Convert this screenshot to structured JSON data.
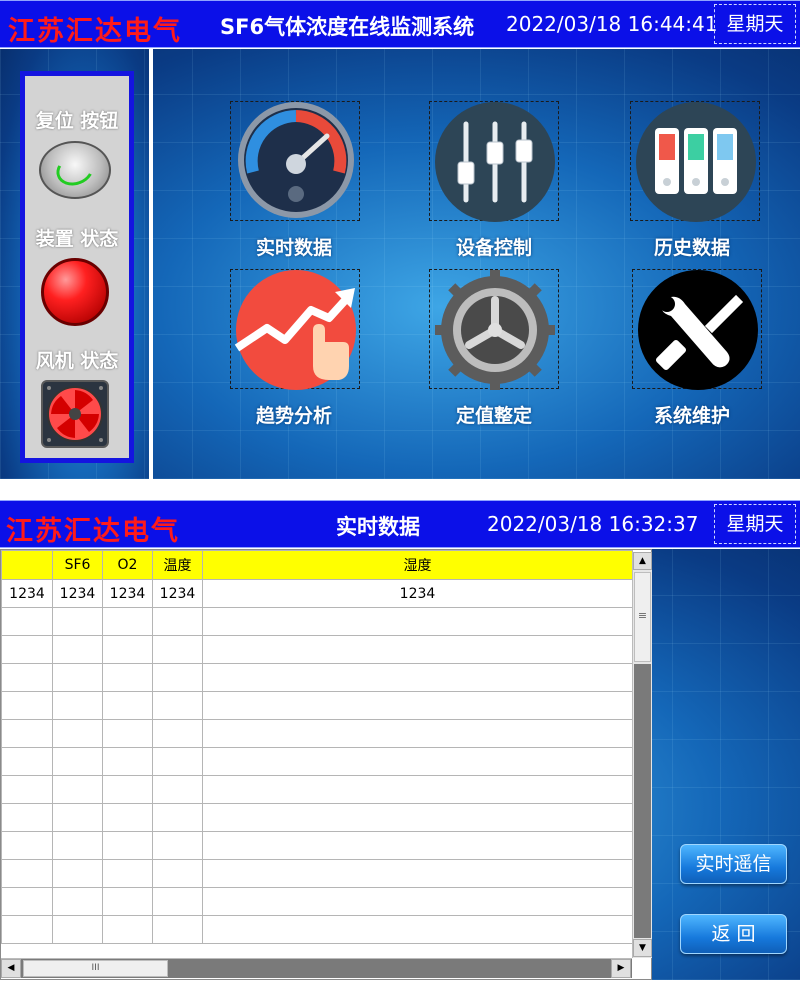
{
  "screen1": {
    "header": {
      "brand": "江苏汇达电气",
      "title": "SF6气体浓度在线监测系统",
      "datetime": "2022/03/18 16:44:41",
      "weekday": "星期天"
    },
    "left_panel": {
      "reset_label": "复位 按钮",
      "device_status_label": "装置 状态",
      "fan_status_label": "风机 状态"
    },
    "menu": [
      {
        "label": "实时数据",
        "icon": "speedometer-icon"
      },
      {
        "label": "设备控制",
        "icon": "sliders-icon"
      },
      {
        "label": "历史数据",
        "icon": "binders-icon"
      },
      {
        "label": "趋势分析",
        "icon": "trend-chart-icon"
      },
      {
        "label": "定值整定",
        "icon": "gear-icon"
      },
      {
        "label": "系统维护",
        "icon": "tools-icon"
      }
    ],
    "colors": {
      "header_bg": "#0b10e8",
      "brand_text": "#ff1a1a",
      "panel_border": "#1414e0",
      "lamp_red": "#ff2020",
      "reset_ring": "#22cc22"
    }
  },
  "screen2": {
    "header": {
      "brand": "江苏汇达电气",
      "title": "实时数据",
      "datetime": "2022/03/18 16:32:37",
      "weekday": "星期天"
    },
    "table": {
      "columns": [
        "",
        "SF6",
        "O2",
        "温度",
        "湿度"
      ],
      "rows": [
        [
          "1234",
          "1234",
          "1234",
          "1234",
          "1234"
        ],
        [
          "",
          "",
          "",
          "",
          ""
        ],
        [
          "",
          "",
          "",
          "",
          ""
        ],
        [
          "",
          "",
          "",
          "",
          ""
        ],
        [
          "",
          "",
          "",
          "",
          ""
        ],
        [
          "",
          "",
          "",
          "",
          ""
        ],
        [
          "",
          "",
          "",
          "",
          ""
        ],
        [
          "",
          "",
          "",
          "",
          ""
        ],
        [
          "",
          "",
          "",
          "",
          ""
        ],
        [
          "",
          "",
          "",
          "",
          ""
        ],
        [
          "",
          "",
          "",
          "",
          ""
        ],
        [
          "",
          "",
          "",
          "",
          ""
        ],
        [
          "",
          "",
          "",
          "",
          ""
        ]
      ]
    },
    "scroll_glyphs": {
      "up": "▲",
      "down": "▼",
      "left": "◀",
      "right": "▶",
      "v_grip": "≡",
      "h_grip": "III"
    },
    "buttons": {
      "telemetry": "实时遥信",
      "back": "返 回"
    },
    "colors": {
      "header_bg": "#0b10e8",
      "table_header_bg": "#ffff00",
      "button_bg": "#1679dc"
    }
  }
}
